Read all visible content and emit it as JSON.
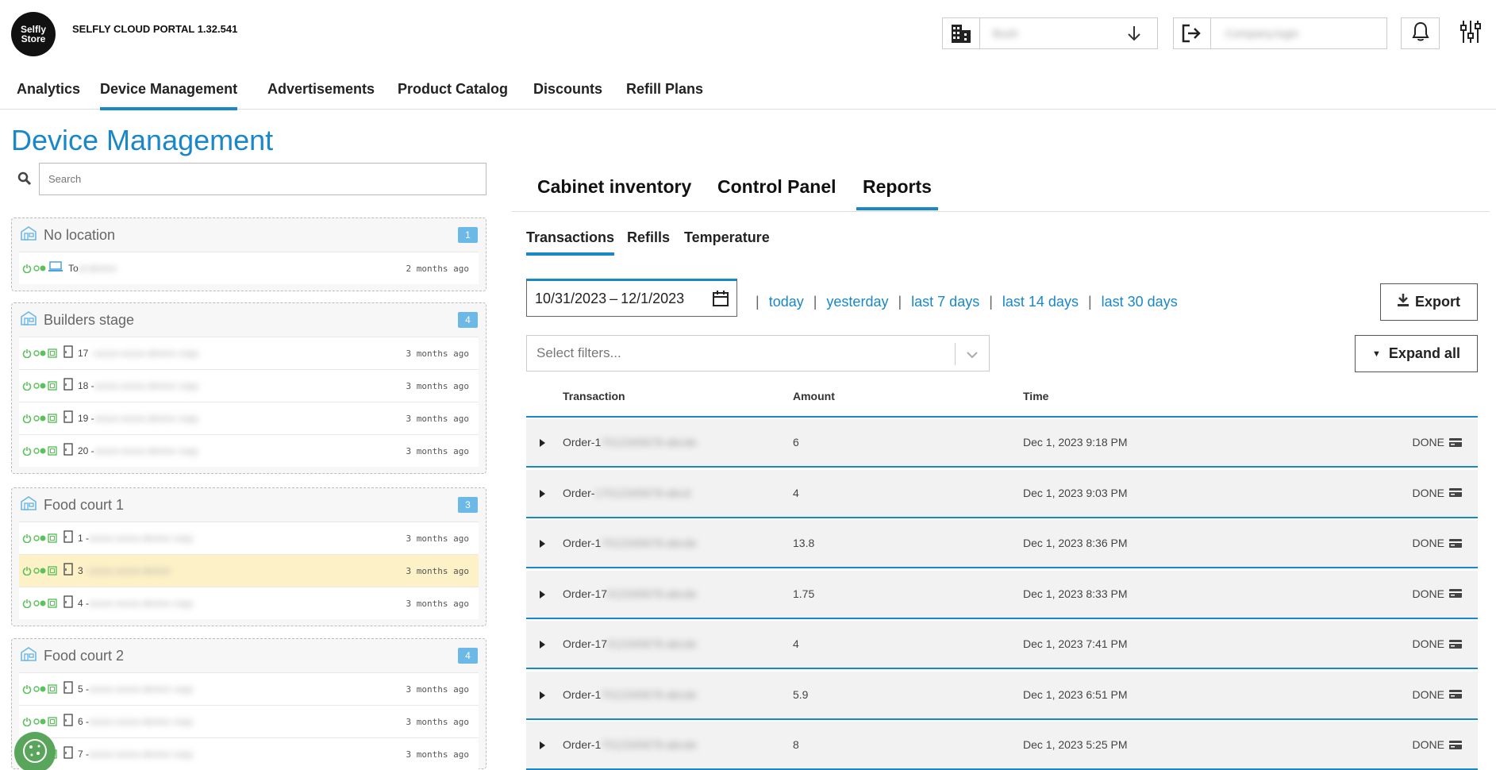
{
  "header": {
    "logo_line1": "Selfly",
    "logo_line2": "Store",
    "app_title": "SELFLY CLOUD PORTAL 1.32.541",
    "org_select_value": "Bush",
    "user_value": "Company.login"
  },
  "nav": [
    "Analytics",
    "Device Management",
    "Advertisements",
    "Product Catalog",
    "Discounts",
    "Refill Plans"
  ],
  "page_title": "Device Management",
  "search": {
    "placeholder": "Search"
  },
  "locations": [
    {
      "name": "No location",
      "count": "1",
      "devices": [
        {
          "name": "To",
          "name_blurred": "st-device",
          "time": "2 months ago",
          "type": "laptop"
        }
      ]
    },
    {
      "name": "Builders stage",
      "count": "4",
      "devices": [
        {
          "name": "17",
          "name_blurred": " - xxxxx-xxxxx-device copy",
          "time": "3 months ago",
          "type": "cabinet"
        },
        {
          "name": "18 -",
          "name_blurred": " xxxxx-xxxxx-device copy",
          "time": "3 months ago",
          "type": "cabinet"
        },
        {
          "name": "19 -",
          "name_blurred": " xxxxx-xxxxx-device copy",
          "time": "3 months ago",
          "type": "cabinet"
        },
        {
          "name": "20 -",
          "name_blurred": " xxxxx-xxxxx-device copy",
          "time": "3 months ago",
          "type": "cabinet"
        }
      ]
    },
    {
      "name": "Food court 1",
      "count": "3",
      "devices": [
        {
          "name": "1 -",
          "name_blurred": " xxxxx-xxxxx-device copy",
          "time": "3 months ago",
          "type": "cabinet"
        },
        {
          "name": "3",
          "name_blurred": " - xxxxx-xxxxx-device",
          "time": "3 months ago",
          "type": "cabinet",
          "highlight": true
        },
        {
          "name": "4 -",
          "name_blurred": " xxxxx-xxxxx-device copy",
          "time": "3 months ago",
          "type": "cabinet"
        }
      ]
    },
    {
      "name": "Food court 2",
      "count": "4",
      "devices": [
        {
          "name": "5 -",
          "name_blurred": " xxxxx-xxxxx-device copy",
          "time": "3 months ago",
          "type": "cabinet"
        },
        {
          "name": "6 -",
          "name_blurred": " xxxxx-xxxxx-device copy",
          "time": "3 months ago",
          "type": "cabinet"
        },
        {
          "name": "7 -",
          "name_blurred": " xxxxx-xxxxx-device copy",
          "time": "3 months ago",
          "type": "cabinet"
        }
      ]
    }
  ],
  "tabs": [
    "Cabinet inventory",
    "Control Panel",
    "Reports"
  ],
  "subtabs": [
    "Transactions",
    "Refills",
    "Temperature"
  ],
  "date_range": {
    "start": "10/31/2023",
    "sep": "–",
    "end": "12/1/2023"
  },
  "quick_ranges": [
    "today",
    "yesterday",
    "last 7 days",
    "last 14 days",
    "last 30 days"
  ],
  "buttons": {
    "export": "Export",
    "expand_all": "Expand all"
  },
  "filter": {
    "placeholder": "Select filters..."
  },
  "table": {
    "headers": [
      "Transaction",
      "Amount",
      "Time"
    ],
    "rows": [
      {
        "order": "Order-1",
        "order_blurred": "7012345678-abcde",
        "amount": "6",
        "time": "Dec 1, 2023 9:18 PM",
        "status": "DONE"
      },
      {
        "order": "Order-",
        "order_blurred": "17012345678-abcd",
        "amount": "4",
        "time": "Dec 1, 2023 9:03 PM",
        "status": "DONE"
      },
      {
        "order": "Order-1",
        "order_blurred": "7012345678-abcde",
        "amount": "13.8",
        "time": "Dec 1, 2023 8:36 PM",
        "status": "DONE"
      },
      {
        "order": "Order-17",
        "order_blurred": "012345678-abcde",
        "amount": "1.75",
        "time": "Dec 1, 2023 8:33 PM",
        "status": "DONE"
      },
      {
        "order": "Order-17",
        "order_blurred": "012345678-abcde",
        "amount": "4",
        "time": "Dec 1, 2023 7:41 PM",
        "status": "DONE"
      },
      {
        "order": "Order-1",
        "order_blurred": "7012345678-abcde",
        "amount": "5.9",
        "time": "Dec 1, 2023 6:51 PM",
        "status": "DONE"
      },
      {
        "order": "Order-1",
        "order_blurred": "7012345678-abcde",
        "amount": "8",
        "time": "Dec 1, 2023 5:25 PM",
        "status": "DONE"
      }
    ]
  },
  "colors": {
    "accent": "#1a87c9",
    "badge": "#6cb8e6",
    "status_green": "#5cc15c",
    "highlight": "#fdf1c7",
    "cookie": "#5aa55c"
  }
}
